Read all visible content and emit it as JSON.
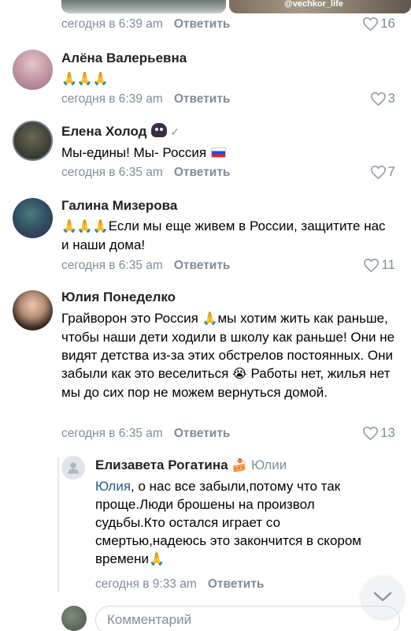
{
  "top_comment_meta": {
    "time": "сегодня в 6:39 am",
    "reply_label": "Ответить",
    "likes": "16",
    "watermark": "@vechkor_life"
  },
  "comments": [
    {
      "author": "Алёна Валерьевна",
      "text": "🙏🙏🙏",
      "time": "сегодня в 6:39 am",
      "reply_label": "Ответить",
      "likes": "3"
    },
    {
      "author": "Елена Холод",
      "verified": "✓",
      "text": "Мы-едины! Мы- Россия",
      "time": "сегодня в 6:35 am",
      "reply_label": "Ответить",
      "likes": "7"
    },
    {
      "author": "Галина Мизерова",
      "text_emoji": "🙏🙏🙏",
      "text": "Если мы еще живем в России, защитите нас и наши дома!",
      "time": "сегодня в 6:35 am",
      "reply_label": "Ответить",
      "likes": "11"
    },
    {
      "author": "Юлия Понеделко",
      "text_part1": "Грайворон это Россия ",
      "emoji1": "🙏",
      "text_part2": "мы хотим жить как раньше, чтобы наши дети ходили в школу как раньше! Они не видят детства из-за этих обстрелов постоянных. Они забыли как это веселиться ",
      "emoji2": "😭",
      "text_part3": " Работы нет, жилья нет мы до сих пор не можем вернуться домой.",
      "time": "сегодня в 6:35 am",
      "reply_label": "Ответить",
      "likes": "13"
    }
  ],
  "reply": {
    "author": "Елизавета Рогатина",
    "author_emoji": "🍰",
    "reply_to": "Юлии",
    "mention": "Юлия",
    "text": ", о нас все забыли,потому что так проще.Люди брошены на произвол судьбы.Кто остался играет со смертью,надеюсь это закончится в скором времени",
    "end_emoji": "🙏",
    "time": "сегодня в 9:33 am",
    "reply_label": "Ответить"
  },
  "comment_input": {
    "placeholder": "Комментарий"
  }
}
